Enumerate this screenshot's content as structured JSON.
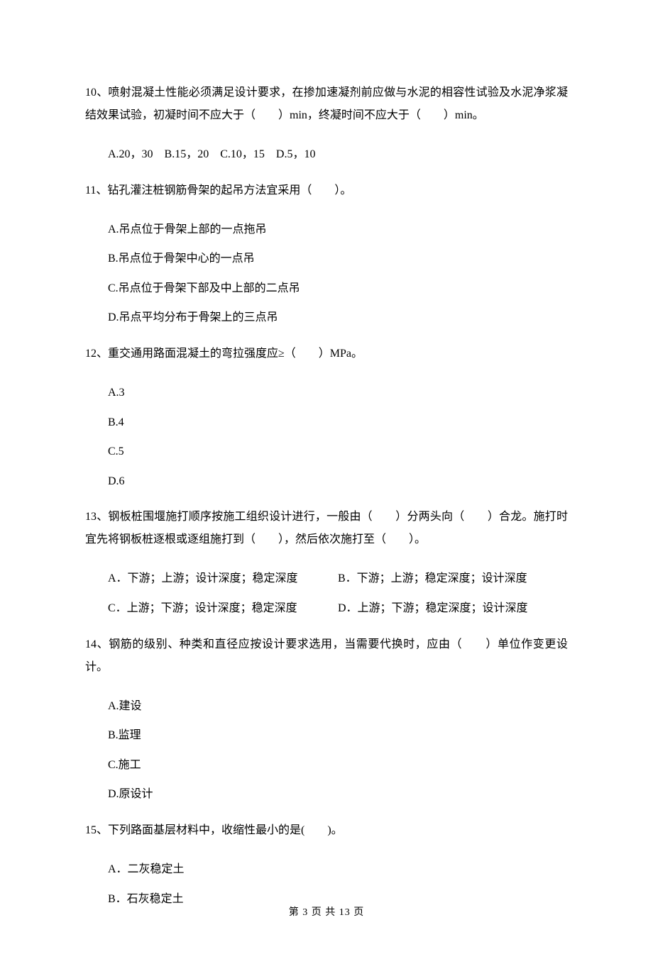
{
  "q10": {
    "stem": "10、喷射混凝土性能必须满足设计要求，在掺加速凝剂前应做与水泥的相容性试验及水泥净浆凝结效果试验，初凝时间不应大于（　　）min，终凝时间不应大于（　　）min。",
    "options": "A.20，30    B.15，20    C.10，15    D.5，10"
  },
  "q11": {
    "stem": "11、钻孔灌注桩钢筋骨架的起吊方法宜采用（　　）。",
    "a": "A.吊点位于骨架上部的一点拖吊",
    "b": "B.吊点位于骨架中心的一点吊",
    "c": "C.吊点位于骨架下部及中上部的二点吊",
    "d": "D.吊点平均分布于骨架上的三点吊"
  },
  "q12": {
    "stem": "12、重交通用路面混凝土的弯拉强度应≥（　　）MPa。",
    "a": "A.3",
    "b": "B.4",
    "c": "C.5",
    "d": "D.6"
  },
  "q13": {
    "stem": "13、钢板桩围堰施打顺序按施工组织设计进行，一般由（　　）分两头向（　　）合龙。施打时宜先将钢板桩逐根或逐组施打到（　　），然后依次施打至（　　）。",
    "a": "A．下游；上游；设计深度；稳定深度",
    "b": "B．下游；上游；稳定深度；设计深度",
    "c": "C．上游；下游；设计深度；稳定深度",
    "d": "D．上游；下游；稳定深度；设计深度"
  },
  "q14": {
    "stem": "14、钢筋的级别、种类和直径应按设计要求选用，当需要代换时，应由（　　）单位作变更设计。",
    "a": "A.建设",
    "b": "B.监理",
    "c": "C.施工",
    "d": "D.原设计"
  },
  "q15": {
    "stem": "15、下列路面基层材料中，收缩性最小的是(　　)。",
    "a": "A．二灰稳定土",
    "b": "B．石灰稳定土"
  },
  "footer": "第 3 页 共 13 页"
}
